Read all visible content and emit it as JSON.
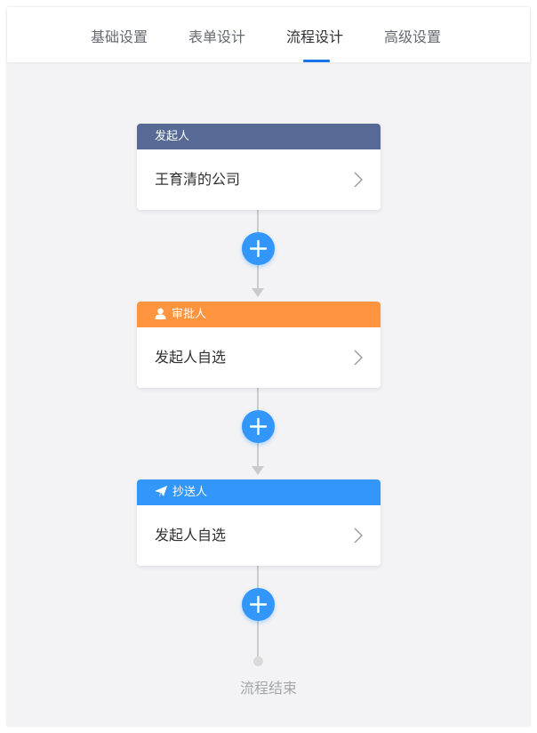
{
  "tabs": [
    {
      "label": "基础设置"
    },
    {
      "label": "表单设计"
    },
    {
      "label": "流程设计",
      "active": true
    },
    {
      "label": "高级设置"
    }
  ],
  "nodes": [
    {
      "type": "发起人",
      "value": "王育清的公司",
      "color": "#576a95",
      "icon": null
    },
    {
      "type": "审批人",
      "value": "发起人自选",
      "color": "#ff943e",
      "icon": "user-icon"
    },
    {
      "type": "抄送人",
      "value": "发起人自选",
      "color": "#3296fa",
      "icon": "send-icon"
    }
  ],
  "end": {
    "label": "流程结束"
  },
  "colors": {
    "accent": "#3296fa",
    "tab_indicator": "#1a73e8",
    "background": "#f3f3f5"
  }
}
